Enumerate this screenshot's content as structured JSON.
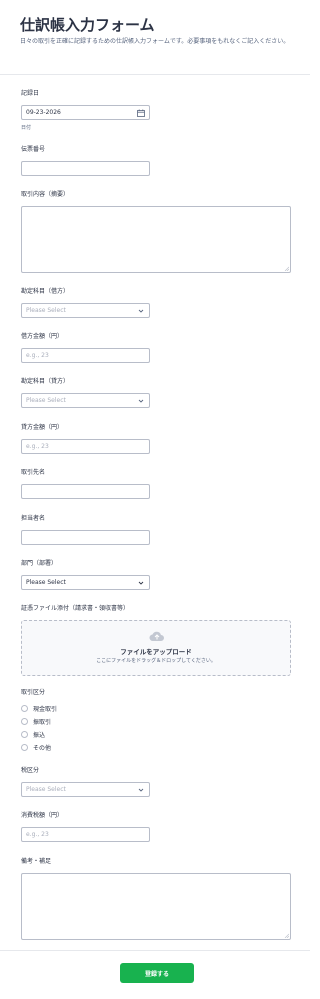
{
  "form": {
    "title": "仕訳帳入力フォーム",
    "subtitle": "日々の取引を正確に記録するための仕訳帳入力フォームです。必要事項をもれなくご記入ください。",
    "date": {
      "label": "記録日",
      "value": "09-23-2026",
      "sublabel": "日付"
    },
    "voucher": {
      "label": "伝票番号"
    },
    "description": {
      "label": "取引内容（摘要）"
    },
    "debit_account": {
      "label": "勘定科目（借方）",
      "placeholder": "Please Select"
    },
    "debit_amount": {
      "label": "借方金額（円）",
      "placeholder": "e.g., 23"
    },
    "credit_account": {
      "label": "勘定科目（貸方）",
      "placeholder": "Please Select"
    },
    "credit_amount": {
      "label": "貸方金額（円）",
      "placeholder": "e.g., 23"
    },
    "client": {
      "label": "取引先名"
    },
    "person": {
      "label": "担当者名"
    },
    "department": {
      "label": "部門（部署）",
      "value": "Please Select"
    },
    "attachment": {
      "label": "証憑ファイル添付（請求書・領収書等）",
      "title": "ファイルをアップロード",
      "hint": "ここにファイルをドラッグ＆ドロップしてください。"
    },
    "transaction_type": {
      "label": "取引区分",
      "options": [
        "現金取引",
        "振取引",
        "振込",
        "その他"
      ]
    },
    "tax_category": {
      "label": "税区分",
      "placeholder": "Please Select"
    },
    "tax_amount": {
      "label": "消費税額（円）",
      "placeholder": "e.g., 23"
    },
    "notes": {
      "label": "備考・補足"
    },
    "submit_label": "登録する"
  }
}
